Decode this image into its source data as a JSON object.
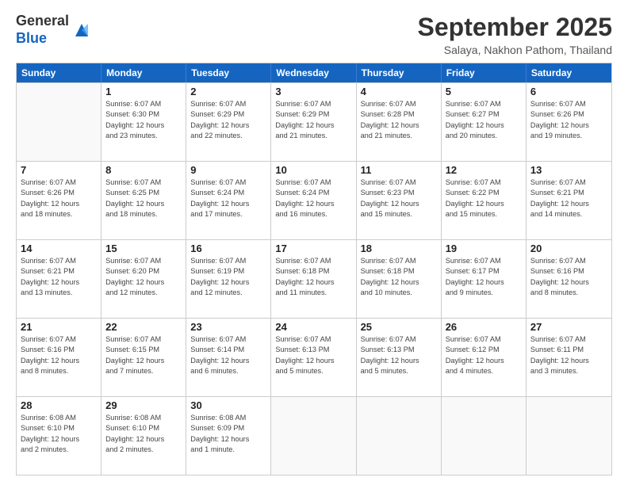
{
  "header": {
    "logo_general": "General",
    "logo_blue": "Blue",
    "month_title": "September 2025",
    "location": "Salaya, Nakhon Pathom, Thailand"
  },
  "weekdays": [
    "Sunday",
    "Monday",
    "Tuesday",
    "Wednesday",
    "Thursday",
    "Friday",
    "Saturday"
  ],
  "rows": [
    [
      {
        "day": "",
        "info": ""
      },
      {
        "day": "1",
        "info": "Sunrise: 6:07 AM\nSunset: 6:30 PM\nDaylight: 12 hours\nand 23 minutes."
      },
      {
        "day": "2",
        "info": "Sunrise: 6:07 AM\nSunset: 6:29 PM\nDaylight: 12 hours\nand 22 minutes."
      },
      {
        "day": "3",
        "info": "Sunrise: 6:07 AM\nSunset: 6:29 PM\nDaylight: 12 hours\nand 21 minutes."
      },
      {
        "day": "4",
        "info": "Sunrise: 6:07 AM\nSunset: 6:28 PM\nDaylight: 12 hours\nand 21 minutes."
      },
      {
        "day": "5",
        "info": "Sunrise: 6:07 AM\nSunset: 6:27 PM\nDaylight: 12 hours\nand 20 minutes."
      },
      {
        "day": "6",
        "info": "Sunrise: 6:07 AM\nSunset: 6:26 PM\nDaylight: 12 hours\nand 19 minutes."
      }
    ],
    [
      {
        "day": "7",
        "info": "Sunrise: 6:07 AM\nSunset: 6:26 PM\nDaylight: 12 hours\nand 18 minutes."
      },
      {
        "day": "8",
        "info": "Sunrise: 6:07 AM\nSunset: 6:25 PM\nDaylight: 12 hours\nand 18 minutes."
      },
      {
        "day": "9",
        "info": "Sunrise: 6:07 AM\nSunset: 6:24 PM\nDaylight: 12 hours\nand 17 minutes."
      },
      {
        "day": "10",
        "info": "Sunrise: 6:07 AM\nSunset: 6:24 PM\nDaylight: 12 hours\nand 16 minutes."
      },
      {
        "day": "11",
        "info": "Sunrise: 6:07 AM\nSunset: 6:23 PM\nDaylight: 12 hours\nand 15 minutes."
      },
      {
        "day": "12",
        "info": "Sunrise: 6:07 AM\nSunset: 6:22 PM\nDaylight: 12 hours\nand 15 minutes."
      },
      {
        "day": "13",
        "info": "Sunrise: 6:07 AM\nSunset: 6:21 PM\nDaylight: 12 hours\nand 14 minutes."
      }
    ],
    [
      {
        "day": "14",
        "info": "Sunrise: 6:07 AM\nSunset: 6:21 PM\nDaylight: 12 hours\nand 13 minutes."
      },
      {
        "day": "15",
        "info": "Sunrise: 6:07 AM\nSunset: 6:20 PM\nDaylight: 12 hours\nand 12 minutes."
      },
      {
        "day": "16",
        "info": "Sunrise: 6:07 AM\nSunset: 6:19 PM\nDaylight: 12 hours\nand 12 minutes."
      },
      {
        "day": "17",
        "info": "Sunrise: 6:07 AM\nSunset: 6:18 PM\nDaylight: 12 hours\nand 11 minutes."
      },
      {
        "day": "18",
        "info": "Sunrise: 6:07 AM\nSunset: 6:18 PM\nDaylight: 12 hours\nand 10 minutes."
      },
      {
        "day": "19",
        "info": "Sunrise: 6:07 AM\nSunset: 6:17 PM\nDaylight: 12 hours\nand 9 minutes."
      },
      {
        "day": "20",
        "info": "Sunrise: 6:07 AM\nSunset: 6:16 PM\nDaylight: 12 hours\nand 8 minutes."
      }
    ],
    [
      {
        "day": "21",
        "info": "Sunrise: 6:07 AM\nSunset: 6:16 PM\nDaylight: 12 hours\nand 8 minutes."
      },
      {
        "day": "22",
        "info": "Sunrise: 6:07 AM\nSunset: 6:15 PM\nDaylight: 12 hours\nand 7 minutes."
      },
      {
        "day": "23",
        "info": "Sunrise: 6:07 AM\nSunset: 6:14 PM\nDaylight: 12 hours\nand 6 minutes."
      },
      {
        "day": "24",
        "info": "Sunrise: 6:07 AM\nSunset: 6:13 PM\nDaylight: 12 hours\nand 5 minutes."
      },
      {
        "day": "25",
        "info": "Sunrise: 6:07 AM\nSunset: 6:13 PM\nDaylight: 12 hours\nand 5 minutes."
      },
      {
        "day": "26",
        "info": "Sunrise: 6:07 AM\nSunset: 6:12 PM\nDaylight: 12 hours\nand 4 minutes."
      },
      {
        "day": "27",
        "info": "Sunrise: 6:07 AM\nSunset: 6:11 PM\nDaylight: 12 hours\nand 3 minutes."
      }
    ],
    [
      {
        "day": "28",
        "info": "Sunrise: 6:08 AM\nSunset: 6:10 PM\nDaylight: 12 hours\nand 2 minutes."
      },
      {
        "day": "29",
        "info": "Sunrise: 6:08 AM\nSunset: 6:10 PM\nDaylight: 12 hours\nand 2 minutes."
      },
      {
        "day": "30",
        "info": "Sunrise: 6:08 AM\nSunset: 6:09 PM\nDaylight: 12 hours\nand 1 minute."
      },
      {
        "day": "",
        "info": ""
      },
      {
        "day": "",
        "info": ""
      },
      {
        "day": "",
        "info": ""
      },
      {
        "day": "",
        "info": ""
      }
    ]
  ]
}
